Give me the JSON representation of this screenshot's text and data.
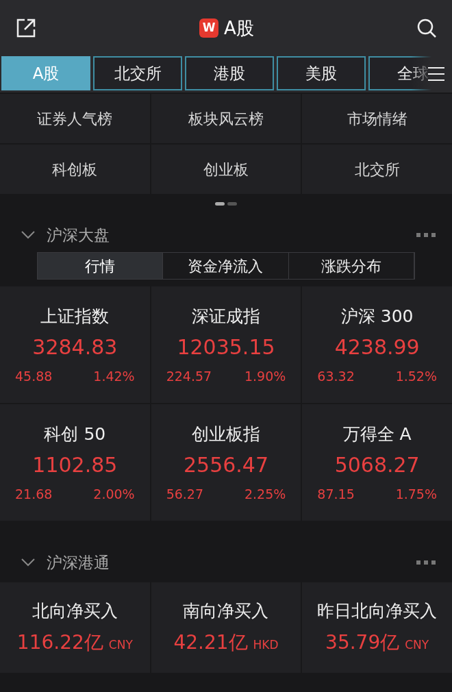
{
  "header": {
    "logo": "W",
    "title": "A股"
  },
  "market_tabs": [
    {
      "label": "A股",
      "selected": true
    },
    {
      "label": "北交所",
      "selected": false
    },
    {
      "label": "港股",
      "selected": false
    },
    {
      "label": "美股",
      "selected": false
    },
    {
      "label": "全球",
      "selected": false
    }
  ],
  "shortcuts": [
    "证券人气榜",
    "板块风云榜",
    "市场情绪",
    "科创板",
    "创业板",
    "北交所"
  ],
  "pager": [
    {
      "selected": true
    },
    {
      "selected": false
    }
  ],
  "sections": [
    {
      "title": "沪深大盘",
      "expanded": true,
      "segments": [
        {
          "label": "行情",
          "selected": true
        },
        {
          "label": "资金净流入",
          "selected": false
        },
        {
          "label": "涨跌分布",
          "selected": false
        }
      ],
      "indices": [
        {
          "name": "上证指数",
          "value": "3284.83",
          "change": "45.88",
          "percent": "1.42%",
          "rising": true
        },
        {
          "name": "深证成指",
          "value": "12035.15",
          "change": "224.57",
          "percent": "1.90%",
          "rising": true
        },
        {
          "name": "沪深 300",
          "value": "4238.99",
          "change": "63.32",
          "percent": "1.52%",
          "rising": true
        },
        {
          "name": "科创 50",
          "value": "1102.85",
          "change": "21.68",
          "percent": "2.00%",
          "rising": true
        },
        {
          "name": "创业板指",
          "value": "2556.47",
          "change": "56.27",
          "percent": "2.25%",
          "rising": true
        },
        {
          "name": "万得全 A",
          "value": "5068.27",
          "change": "87.15",
          "percent": "1.75%",
          "rising": true
        }
      ]
    },
    {
      "title": "沪深港通",
      "expanded": true,
      "flows": [
        {
          "name": "北向净买入",
          "value": "116.22亿",
          "currency": "CNY",
          "rising": true
        },
        {
          "name": "南向净买入",
          "value": "42.21亿",
          "currency": "HKD",
          "rising": true
        },
        {
          "name": "昨日北向净买入",
          "value": "35.79亿",
          "currency": "CNY",
          "rising": true
        }
      ]
    }
  ]
}
